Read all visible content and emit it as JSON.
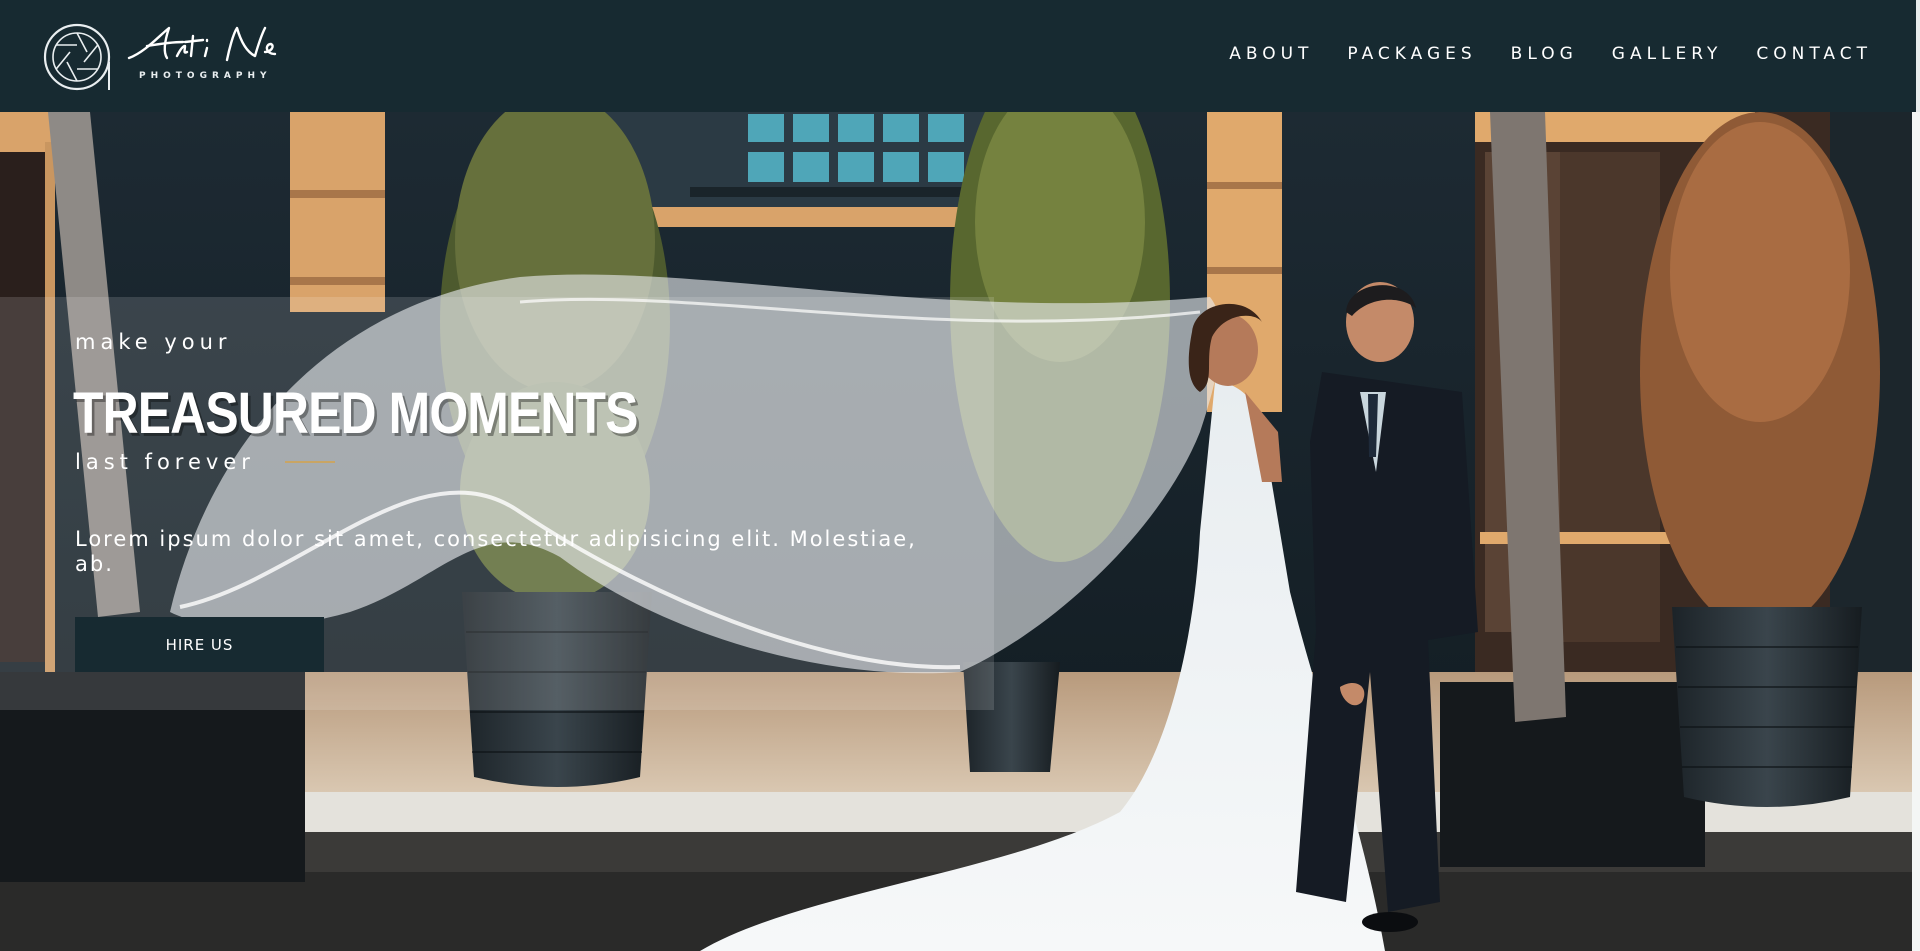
{
  "brand": {
    "script_name": "Arti Ne",
    "tagline": "PHOTOGRAPHY"
  },
  "nav": {
    "items": [
      {
        "label": "ABOUT"
      },
      {
        "label": "PACKAGES"
      },
      {
        "label": "BLOG"
      },
      {
        "label": "GALLERY"
      },
      {
        "label": "CONTACT"
      }
    ]
  },
  "hero": {
    "kicker": "make your",
    "headline": "TREASURED MOMENTS",
    "subheadline": "last forever",
    "description": "Lorem ipsum dolor sit amet, consectetur adipisicing elit. Molestiae, ab.",
    "cta_label": "HIRE US",
    "photo_subject": "bride-and-groom-photo"
  },
  "colors": {
    "header_bg": "#172a31",
    "button_bg": "#172a31",
    "accent_line": "#c9a564",
    "text": "#ffffff"
  }
}
